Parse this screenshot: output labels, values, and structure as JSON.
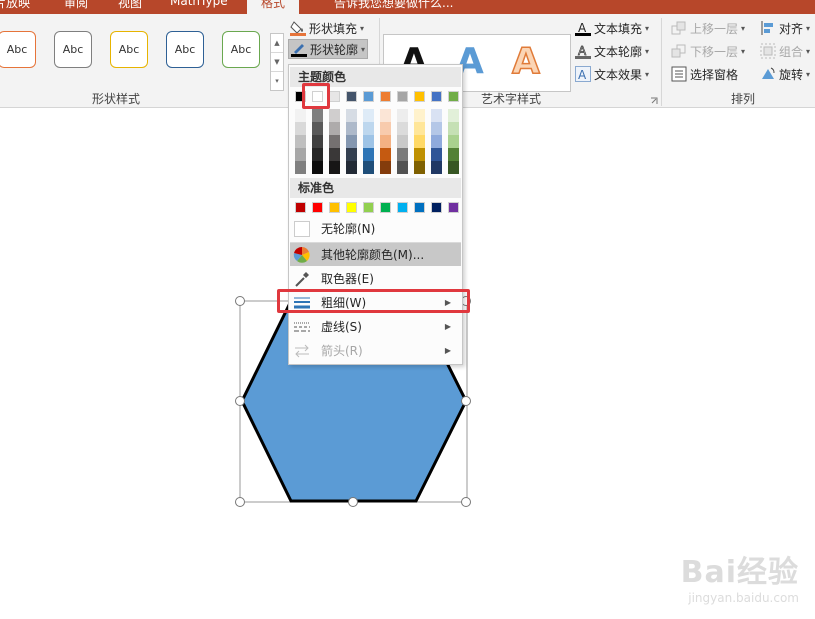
{
  "tabs": [
    {
      "label": "片放映"
    },
    {
      "label": "审阅"
    },
    {
      "label": "视图"
    },
    {
      "label": "MathType"
    },
    {
      "label": "格式"
    },
    {
      "label": "告诉我您想要做什么..."
    }
  ],
  "shape_styles": {
    "group_label": "形状样式",
    "presets": [
      {
        "label": "Abc",
        "border": "#e6743a"
      },
      {
        "label": "Abc",
        "border": "#7f7f7f"
      },
      {
        "label": "Abc",
        "border": "#e7b400"
      },
      {
        "label": "Abc",
        "border": "#2e6095"
      },
      {
        "label": "Abc",
        "border": "#6aa84f"
      }
    ],
    "fill_label": "形状填充",
    "outline_label": "形状轮廓"
  },
  "wordart": {
    "group_label": "艺术字样式",
    "samples": [
      {
        "letter": "A",
        "color": "#111111"
      },
      {
        "letter": "A",
        "color": "#5b9bd5"
      },
      {
        "letter": "A",
        "color": "#f4b183"
      }
    ],
    "text_fill": "文本填充",
    "text_outline": "文本轮廓",
    "text_effect": "文本效果"
  },
  "arrange": {
    "group_label": "排列",
    "bring_forward": "上移一层",
    "send_backward": "下移一层",
    "selection_pane": "选择窗格",
    "align": "对齐",
    "group": "组合",
    "rotate": "旋转"
  },
  "menu": {
    "theme_colors_header": "主题颜色",
    "standard_colors_header": "标准色",
    "theme_top_row": [
      "#000000",
      "#ffffff",
      "#e7e6e6",
      "#44546a",
      "#5b9bd5",
      "#ed7d31",
      "#a5a5a5",
      "#ffc000",
      "#4472c4",
      "#70ad47"
    ],
    "theme_shades": [
      [
        "#f2f2f2",
        "#d9d9d9",
        "#bfbfbf",
        "#a6a6a6",
        "#7f7f7f"
      ],
      [
        "#7f7f7f",
        "#595959",
        "#404040",
        "#262626",
        "#0d0d0d"
      ],
      [
        "#d0cece",
        "#aeabab",
        "#757171",
        "#3a3838",
        "#171616"
      ],
      [
        "#d6dce4",
        "#adb9ca",
        "#8497b0",
        "#333f4f",
        "#222a35"
      ],
      [
        "#deebf7",
        "#bdd7ee",
        "#9dc3e6",
        "#2e75b6",
        "#1f4e79"
      ],
      [
        "#fbe5d6",
        "#f8cbad",
        "#f4b183",
        "#c55a11",
        "#843c0c"
      ],
      [
        "#ededed",
        "#dbdbdb",
        "#c9c9c9",
        "#7b7b7b",
        "#525252"
      ],
      [
        "#fff2cc",
        "#ffe699",
        "#ffd966",
        "#bf9000",
        "#7f6000"
      ],
      [
        "#d9e2f3",
        "#b4c7e7",
        "#8faadc",
        "#2f5597",
        "#203864"
      ],
      [
        "#e2f0d9",
        "#c5e0b4",
        "#a9d18e",
        "#538135",
        "#375623"
      ]
    ],
    "standard": [
      "#c00000",
      "#ff0000",
      "#ffc000",
      "#ffff00",
      "#92d050",
      "#00b050",
      "#00b0f0",
      "#0070c0",
      "#002060",
      "#7030a0"
    ],
    "no_outline": "无轮廓(N)",
    "more_colors": "其他轮廓颜色(M)...",
    "eyedropper": "取色器(E)",
    "weight": "粗细(W)",
    "dashes": "虚线(S)",
    "arrows": "箭头(R)"
  },
  "shape": {
    "fill": "#5b9bd5",
    "outline": "#000000"
  },
  "watermark": {
    "brand": "Bai经验",
    "url": "jingyan.baidu.com"
  },
  "icons": [
    "paint-bucket-icon",
    "pencil-icon",
    "text-fill-icon",
    "text-outline-icon",
    "text-effect-icon",
    "bring-forward-icon",
    "send-backward-icon",
    "selection-pane-icon",
    "align-icon",
    "group-icon",
    "rotate-icon",
    "no-outline-icon",
    "color-wheel-icon",
    "eyedropper-icon",
    "line-weight-icon",
    "dash-icon",
    "arrow-icon",
    "dialog-launcher-icon",
    "scroll-up-icon",
    "scroll-down-icon",
    "gallery-more-icon"
  ]
}
